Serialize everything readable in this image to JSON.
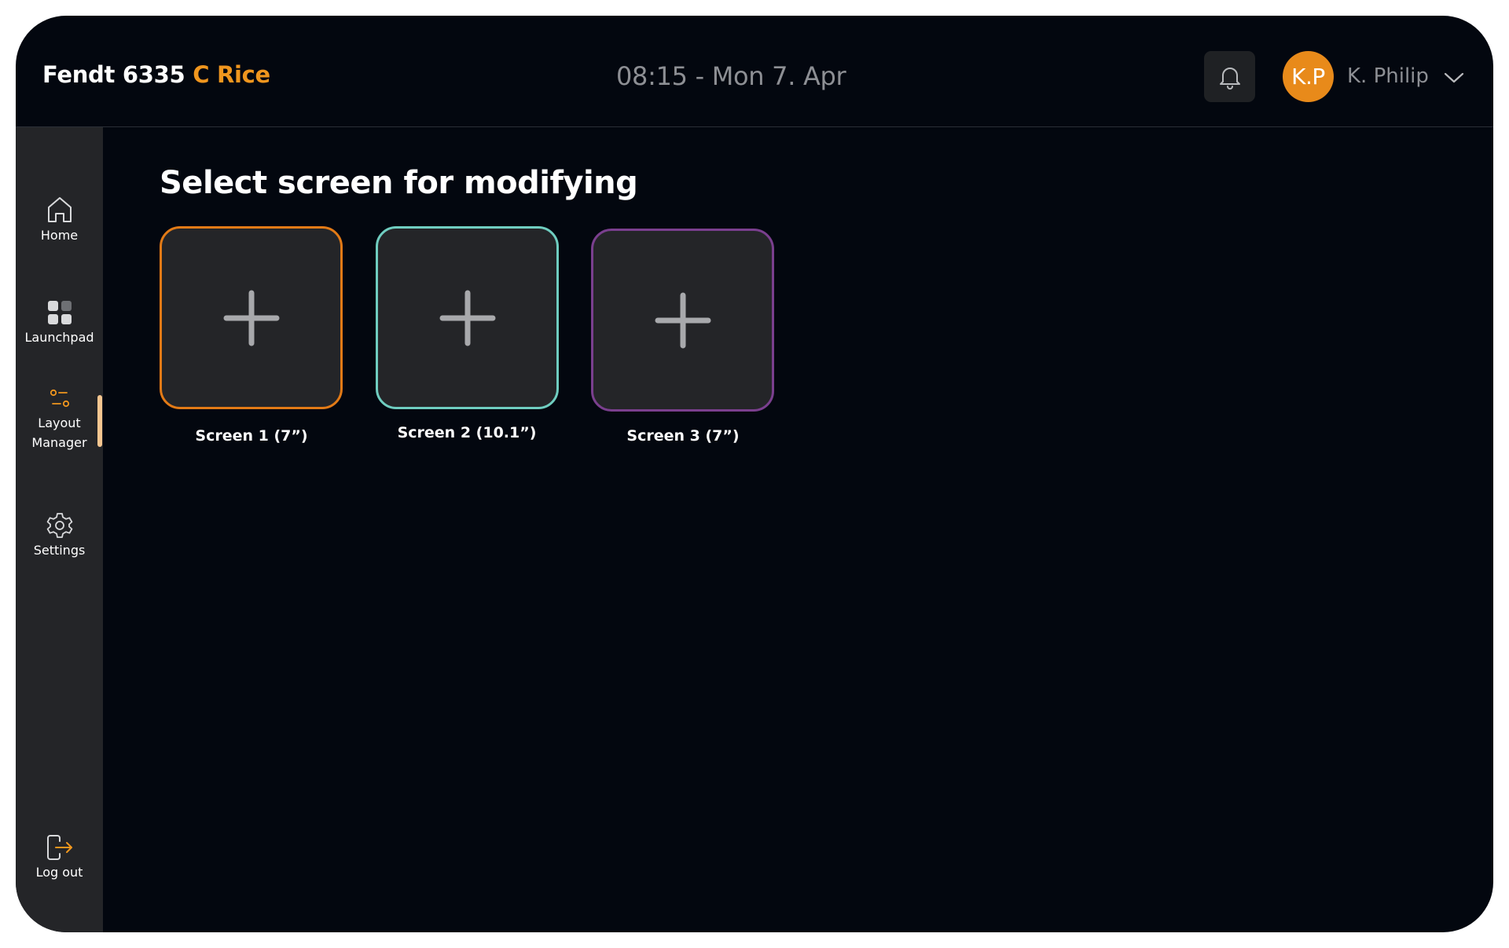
{
  "header": {
    "title_main": "Fendt 6335",
    "title_accent": "C Rice",
    "datetime": "08:15 - Mon 7. Apr",
    "notification_icon": "bell-icon",
    "user_initials": "K.P",
    "user_name": "K. Philip",
    "user_menu_icon": "chevron-down-icon"
  },
  "sidebar": {
    "items": [
      {
        "label": "Home",
        "icon": "home-icon"
      },
      {
        "label": "Launchpad",
        "icon": "grid-icon"
      },
      {
        "label_line1": "Layout",
        "label_line2": "Manager",
        "icon": "sliders-icon",
        "active": true
      },
      {
        "label": "Settings",
        "icon": "gear-icon"
      },
      {
        "label": "Log out",
        "icon": "logout-icon"
      }
    ]
  },
  "main": {
    "title": "Select screen for modifying",
    "screens": [
      {
        "label": "Screen 1 (7”)",
        "border_color": "#e27a16",
        "icon": "plus-icon"
      },
      {
        "label": "Screen 2 (10.1”)",
        "border_color": "#6fcdc0",
        "icon": "plus-icon"
      },
      {
        "label": "Screen 3 (7”)",
        "border_color": "#7a3f8e",
        "icon": "plus-icon"
      }
    ]
  },
  "colors": {
    "background": "#03070f",
    "sidebar": "#242528",
    "accent": "#f0961e",
    "avatar": "#e88a1a",
    "muted_text": "#8d8f94",
    "active_indicator": "#f5c690"
  }
}
